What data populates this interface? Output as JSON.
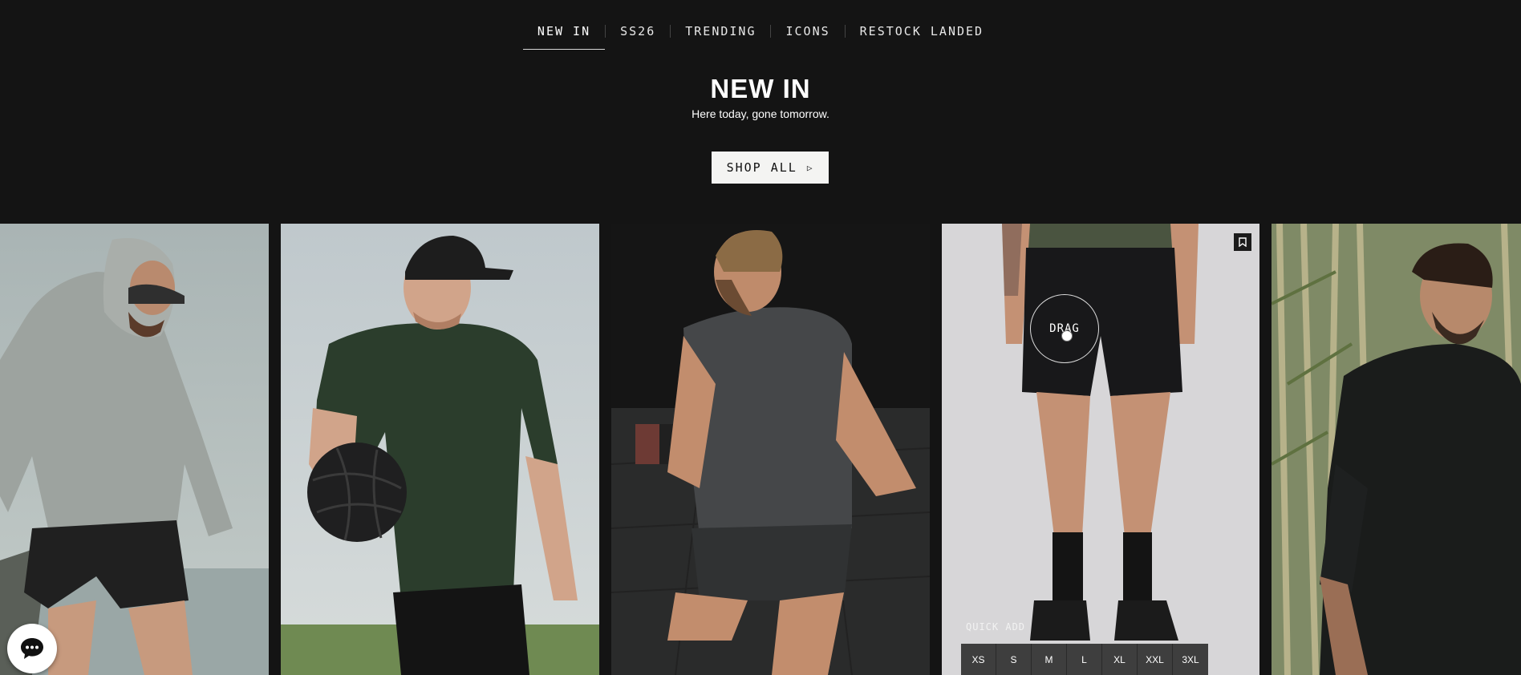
{
  "tabs": [
    {
      "label": "NEW IN",
      "active": true
    },
    {
      "label": "SS26",
      "active": false
    },
    {
      "label": "TRENDING",
      "active": false
    },
    {
      "label": "ICONS",
      "active": false
    },
    {
      "label": "RESTOCK LANDED",
      "active": false
    }
  ],
  "header": {
    "title": "NEW IN",
    "subtitle": "Here today, gone tomorrow.",
    "cta_label": "SHOP ALL",
    "cta_icon": "play-icon"
  },
  "products": [
    {
      "name": "grey hooded jacket and black shorts",
      "icons": []
    },
    {
      "name": "green t-shirt with cap and medicine ball",
      "icons": []
    },
    {
      "name": "grey t-shirt in gym",
      "icons": []
    },
    {
      "name": "black shorts",
      "icons": [
        "bookmark-icon"
      ]
    },
    {
      "name": "black overshirt",
      "icons": []
    }
  ],
  "carousel": {
    "drag_label": "DRAG"
  },
  "quick_add": {
    "label": "QUICK ADD",
    "sizes": [
      "XS",
      "S",
      "M",
      "L",
      "XL",
      "XXL",
      "3XL"
    ]
  },
  "chat": {
    "icon": "chat-bubble-icon"
  },
  "colors": {
    "background": "#141414",
    "cta_background": "#f4f4f2",
    "size_button": "#3e3e3e"
  }
}
